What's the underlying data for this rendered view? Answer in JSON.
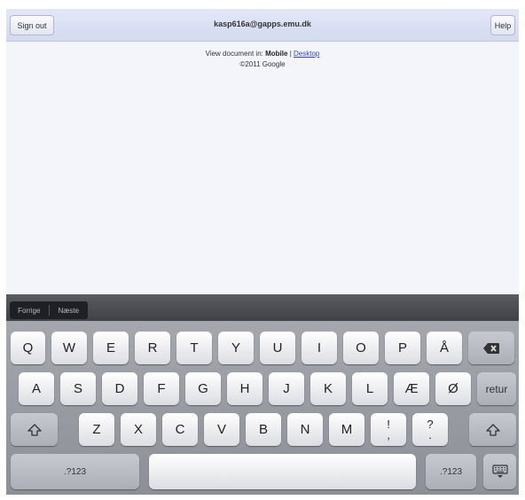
{
  "topbar": {
    "sign_out": "Sign out",
    "account": "kasp616a@gapps.emu.dk",
    "help": "Help"
  },
  "document": {
    "view_prefix": "View document in:",
    "mode_mobile": "Mobile",
    "separator": "|",
    "mode_desktop": "Desktop",
    "copyright": "©2011 Google"
  },
  "keyboard": {
    "prev": "Forrige",
    "next": "Næste",
    "row1": [
      "Q",
      "W",
      "E",
      "R",
      "T",
      "Y",
      "U",
      "I",
      "O",
      "P",
      "Å"
    ],
    "row2": [
      "A",
      "S",
      "D",
      "F",
      "G",
      "H",
      "J",
      "K",
      "L",
      "Æ",
      "Ø"
    ],
    "return_label": "retur",
    "row3": [
      "Z",
      "X",
      "C",
      "V",
      "B",
      "N",
      "M"
    ],
    "excl": [
      "!",
      ","
    ],
    "quest": [
      "?",
      "."
    ],
    "numbers_label": ".?123",
    "icons": {
      "backspace": "backspace-icon",
      "shift": "shift-icon",
      "hide": "keyboard-hide-icon"
    }
  }
}
